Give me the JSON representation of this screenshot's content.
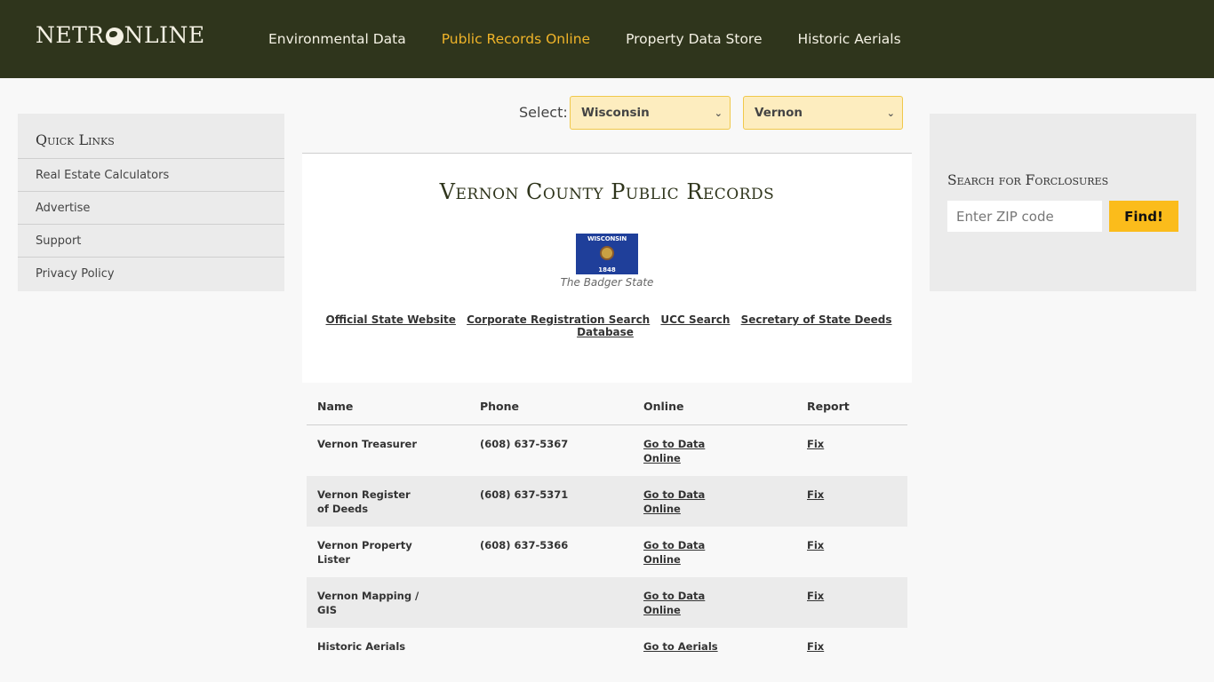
{
  "header": {
    "logo": {
      "before": "NETR",
      "after": "NLINE",
      "globe_icon": "globe-icon"
    },
    "nav": [
      {
        "label": "Environmental Data",
        "active": false
      },
      {
        "label": "Public Records Online",
        "active": true
      },
      {
        "label": "Property Data Store",
        "active": false
      },
      {
        "label": "Historic Aerials",
        "active": false
      }
    ],
    "colors": {
      "bg": "#2f351c",
      "active": "#f0b429"
    }
  },
  "quick_links": {
    "title": "Quick Links",
    "items": [
      "Real Estate Calculators",
      "Advertise",
      "Support",
      "Privacy Policy"
    ]
  },
  "selector": {
    "label": "Select:",
    "state": "Wisconsin",
    "county": "Vernon"
  },
  "main": {
    "title": "Vernon County Public Records",
    "flag": {
      "text": "WISCONSIN",
      "year": "1848"
    },
    "nickname": "The Badger State",
    "state_links": [
      "Official State Website",
      "Corporate Registration Search",
      "UCC Search",
      "Secretary of State Deeds Database"
    ]
  },
  "table": {
    "headers": [
      "Name",
      "Phone",
      "Online",
      "Report"
    ],
    "rows": [
      {
        "name": "Vernon Treasurer",
        "phone": "(608) 637-5367",
        "online": "Go to Data Online",
        "report": "Fix"
      },
      {
        "name": "Vernon Register of Deeds",
        "phone": "(608) 637-5371",
        "online": "Go to Data Online",
        "report": "Fix"
      },
      {
        "name": "Vernon Property Lister",
        "phone": "(608) 637-5366",
        "online": "Go to Data Online",
        "report": "Fix"
      },
      {
        "name": "Vernon Mapping / GIS",
        "phone": "",
        "online": "Go to Data Online",
        "report": "Fix"
      },
      {
        "name": "Historic Aerials",
        "phone": "",
        "online": "Go to Aerials",
        "report": "Fix"
      }
    ]
  },
  "foreclosure": {
    "title": "Search for Forclosures",
    "placeholder": "Enter ZIP code",
    "button": "Find!"
  }
}
